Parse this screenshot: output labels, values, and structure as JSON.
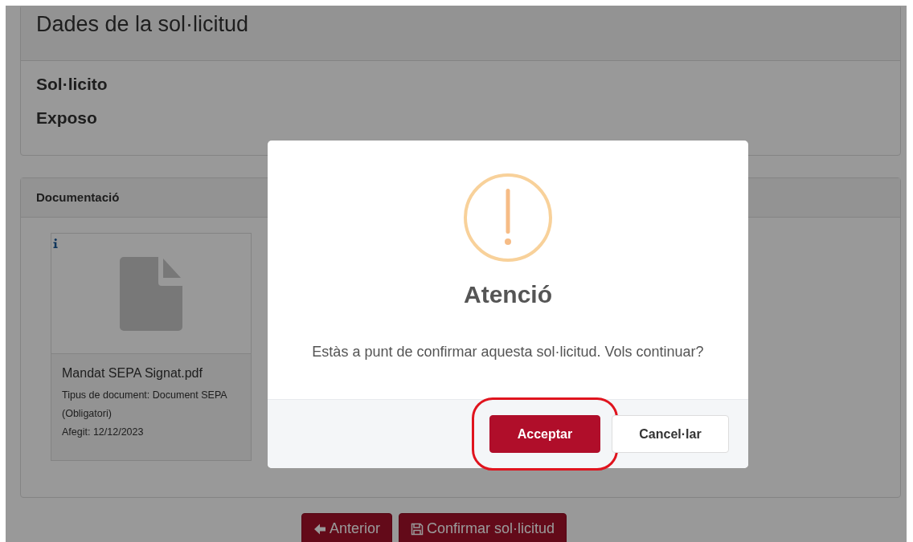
{
  "page": {
    "title": "Dades de la sol·licitud",
    "sections": [
      "Sol·licito",
      "Exposo"
    ]
  },
  "documents": {
    "title": "Documentació",
    "files": [
      {
        "name": "Mandat SEPA Signat.pdf",
        "type": "Tipus de document: Document SEPA (Obligatori)",
        "added": "Afegit: 12/12/2023"
      }
    ]
  },
  "nav_buttons": [
    {
      "kind": "back",
      "label": "Anterior"
    },
    {
      "kind": "save",
      "label": "Confirmar sol·licitud"
    }
  ],
  "dialog": {
    "title": "Atenció",
    "message": "Estàs a punt de confirmar aquesta sol·licitud. Vols continuar?",
    "buttons": [
      {
        "kind": "primary",
        "label": "Acceptar",
        "highlighted": true
      },
      {
        "kind": "secondary",
        "label": "Cancel·lar",
        "highlighted": false
      }
    ]
  }
}
